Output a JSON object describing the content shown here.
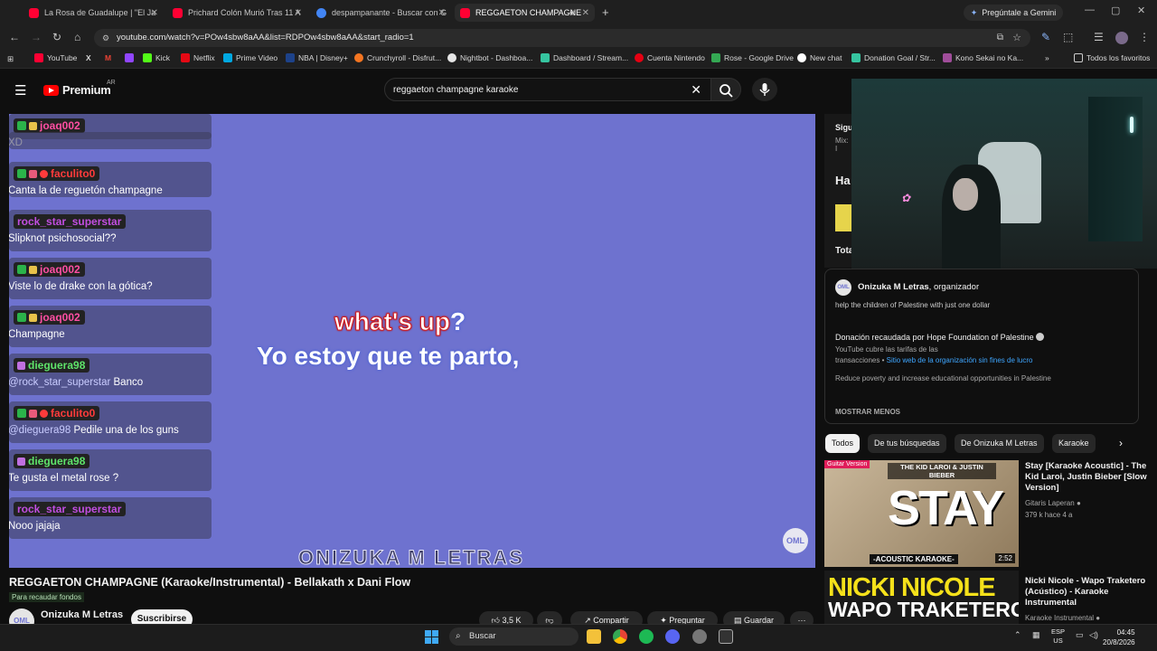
{
  "browser": {
    "tabs": [
      {
        "label": "La Rosa de Guadalupe | \"El Ja",
        "color": "#ff0033"
      },
      {
        "label": "Prichard Colón Murió Tras 11 A",
        "color": "#ff0033"
      },
      {
        "label": "despampanante - Buscar con G",
        "color": "#4285f4"
      },
      {
        "label": "REGGAETON CHAMPAGNE",
        "color": "#ff0033"
      }
    ],
    "gemini_label": "Pregúntale a Gemini",
    "url": "youtube.com/watch?v=POw4sbw8aAA&list=RDPOw4sbw8aAA&start_radio=1",
    "bookmarks": [
      "YouTube",
      "X",
      "M",
      "",
      "Kick",
      "Netflix",
      "Prime Video",
      "NBA | Disney+",
      "Crunchyroll - Disfrut...",
      "Nightbot - Dashboa...",
      "Dashboard / Stream...",
      "Cuenta Nintendo",
      "Rose - Google Drive",
      "New chat",
      "Donation Goal / Str...",
      "Kono Sekai no Ka..."
    ],
    "bookmarks_all": "Todos los favoritos"
  },
  "youtube": {
    "logo_text": "Premium",
    "logo_country": "AR",
    "search_value": "reggaeton champagne karaoke"
  },
  "chat": [
    {
      "user": "joaq002",
      "color": "#ff4fa3",
      "msg": "XD",
      "badges": "check-pool"
    },
    {
      "user": "faculito0",
      "color": "#ff3b3b",
      "msg": "Canta la de reguetón champagne",
      "badges": "check-rose-star"
    },
    {
      "user": "rock_star_superstar",
      "color": "#c14ee0",
      "msg": "Slipknot psichosocial??",
      "badges": ""
    },
    {
      "user": "joaq002",
      "color": "#ff4fa3",
      "msg": "Viste lo de drake con la gótica?",
      "badges": "check-pool"
    },
    {
      "user": "joaq002",
      "color": "#ff4fa3",
      "msg": "Champagne",
      "badges": "check-pool"
    },
    {
      "user": "dieguera98",
      "color": "#5ee36a",
      "mention": "@rock_star_superstar",
      "msg": "Banco",
      "badges": "gift"
    },
    {
      "user": "faculito0",
      "color": "#ff3b3b",
      "mention": "@dieguera98",
      "msg": "Pedile una de los guns",
      "badges": "check-rose-star"
    },
    {
      "user": "dieguera98",
      "color": "#5ee36a",
      "msg": "Te gusta el metal rose ?",
      "badges": "gift"
    },
    {
      "user": "rock_star_superstar",
      "color": "#c14ee0",
      "msg": "Nooo jajaja",
      "badges": ""
    }
  ],
  "video": {
    "lyric_line1_sung": "what's up",
    "lyric_line1_rest": "?",
    "lyric_line2": "Yo estoy que te parto,",
    "watermark": "ONIZUKA M LETRAS",
    "badge": "OML",
    "title": "REGGAETON CHAMPAGNE (Karaoke/Instrumental) - Bellakath x Dani Flow",
    "fund_label": "Para recaudar fondos",
    "channel": "Onizuka M Letras",
    "subscribe": "Suscribirse",
    "likes": "3,5 K",
    "share": "Compartir",
    "ask": "Preguntar",
    "save": "Guardar"
  },
  "sidebar": {
    "partial_top": "Sigu",
    "partial_top2": "Mix: I",
    "partial_ha": "Ha",
    "partial_tota": "Tota",
    "org_name": "Onizuka M Letras",
    "org_role": ", organizador",
    "org_desc": "help the children of Palestine with just one dollar",
    "donation_title": "Donación recaudada por Hope Foundation of Palestine",
    "donation_fee": "YouTube cubre las tarifas de las",
    "donation_fee2": "transacciones",
    "donation_link": "Sitio web de la organización sin fines de lucro",
    "donation_desc": "Reduce poverty and increase educational opportunities in Palestine",
    "show_less": "MOSTRAR MENOS",
    "chips": [
      "Todos",
      "De tus búsquedas",
      "De Onizuka M Letras",
      "Karaoke"
    ],
    "reco": [
      {
        "title": "Stay [Karaoke Acoustic] - The Kid Laroi, Justin Bieber [Slow Version]",
        "channel": "Gitaris Laperan",
        "meta": "379 k  hace 4 a",
        "duration": "2:52",
        "thumb_tag": "Guitar Version",
        "thumb_top": "THE KID LAROI & JUSTIN BIEBER",
        "thumb_big": "STAY",
        "thumb_bottom": "-ACOUSTIC KARAOKE-"
      },
      {
        "title": "Nicki Nicole - Wapo Traketero (Acústico) - Karaoke Instrumental",
        "channel": "Karaoke Instrumental",
        "thumb_big": "NICKI NICOLE",
        "thumb_sub": "WAPO TRAKETERO"
      }
    ]
  },
  "taskbar": {
    "search": "Buscar",
    "lang1": "ESP",
    "lang2": "US",
    "time": "04:45",
    "date": "20/8/2026"
  }
}
